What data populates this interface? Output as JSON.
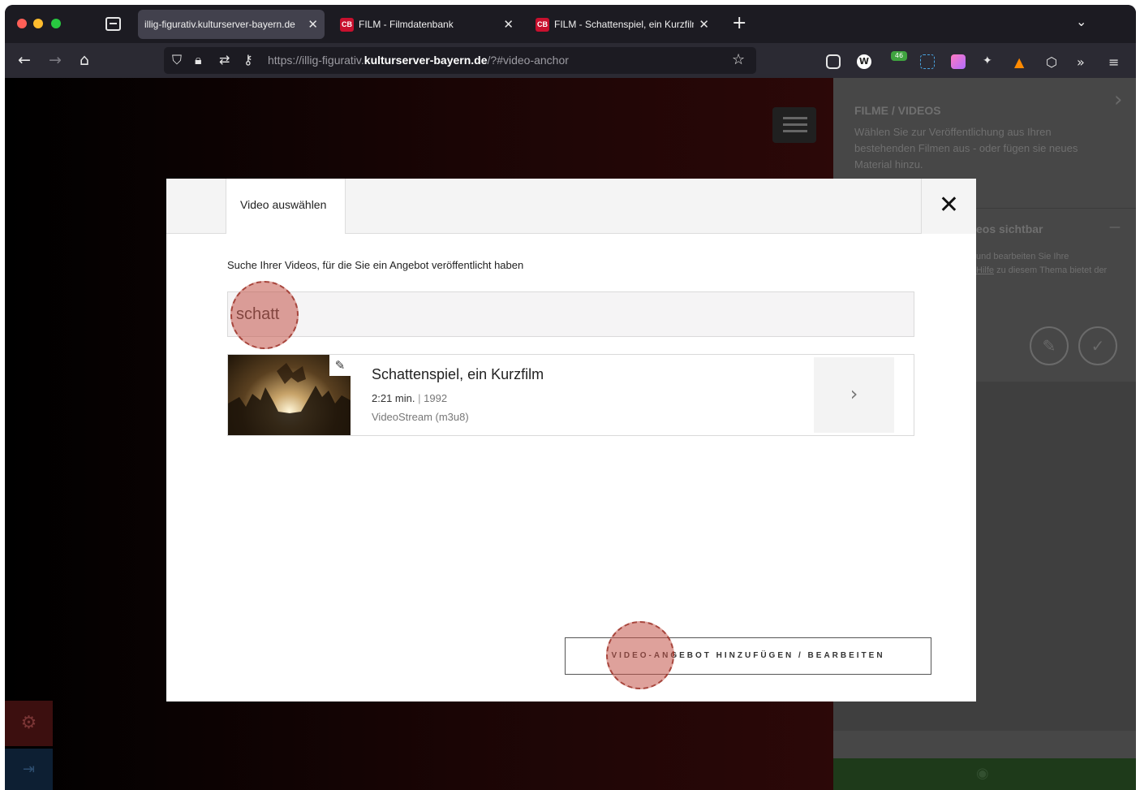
{
  "browser": {
    "tabs": [
      {
        "label": "illig-figurativ.kulturserver-bayern.de",
        "favicon": "",
        "active": true
      },
      {
        "label": "FILM - Filmdatenbank",
        "favicon": "CB",
        "active": false
      },
      {
        "label": "FILM - Schattenspiel, ein Kurzfilm",
        "favicon": "CB",
        "active": false
      }
    ],
    "url": {
      "prefix": "https://illig-figurativ.",
      "domain": "kulturserver-bayern.de",
      "suffix": "/?#video-anchor"
    }
  },
  "right_panel": {
    "title": "FILME / VIDEOS",
    "description": "Wählen Sie zur Veröffentlichung aus Ihren bestehenden Filmen aus - oder fügen sie neues Material hinzu.",
    "subtitle": "eos sichtbar",
    "subdesc_pre": "und bearbeiten Sie Ihre",
    "subdesc_link": "Hilfe",
    "subdesc_post": "zu diesem Thema bietet der"
  },
  "modal": {
    "tab_label": "Video auswählen",
    "search_label": "Suche Ihrer Videos, für die Sie ein Angebot veröffentlicht haben",
    "search_value": "schatt",
    "result": {
      "title": "Schattenspiel, ein Kurzfilm",
      "duration": "2:21 min.",
      "separator": "|",
      "year": "1992",
      "format": "VideoStream (m3u8)"
    },
    "submit_label": "VIDEO-ANGEBOT HINZUFÜGEN / BEARBEITEN"
  },
  "colors": {
    "accent_red": "#c8102e",
    "marker": "#c25448",
    "panel_green": "#1e3a1a"
  }
}
